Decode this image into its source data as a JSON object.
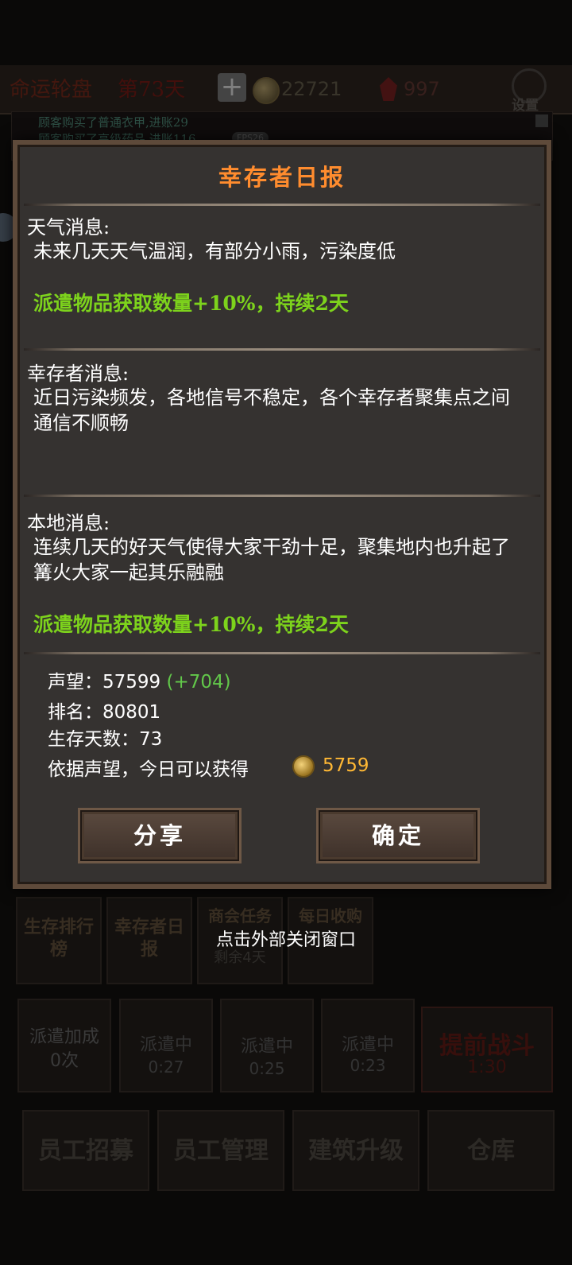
{
  "topbar": {
    "title": "命运轮盘",
    "day": "第73天",
    "coins": "22721",
    "gems": "997",
    "settings_label": "设置"
  },
  "log": {
    "line1": "顾客购买了普通衣甲,进账29",
    "line2": "顾客购买了高级药品,进账116",
    "badge": "FPS26"
  },
  "dialog": {
    "title": "幸存者日报",
    "weather": {
      "heading": "天气消息:",
      "text": "未来几天天气温润，有部分小雨，污染度低",
      "bonus": "派遣物品获取数量+10%，持续2天"
    },
    "survivor": {
      "heading": "幸存者消息:",
      "text": "近日污染频发，各地信号不稳定，各个幸存者聚集点之间通信不顺畅"
    },
    "local": {
      "heading": "本地消息:",
      "text": "连续几天的好天气使得大家干劲十足，聚集地内也升起了篝火大家一起其乐融融",
      "bonus": "派遣物品获取数量+10%，持续2天"
    },
    "stats": {
      "reputation_label": "声望：",
      "reputation_value": "57599",
      "reputation_delta": "(+704)",
      "rank_label": "排名：",
      "rank_value": "80801",
      "days_label": "生存天数：",
      "days_value": "73",
      "reward_label": "依据声望，今日可以获得",
      "reward_value": "5759"
    },
    "share_button": "分享",
    "confirm_button": "确定"
  },
  "hint": "点击外部关闭窗口",
  "menu": {
    "tile1": "生存排行榜",
    "tile2": "幸存者日报",
    "tile3": "商会任务",
    "tile3_sub": "剩余4天",
    "tile4": "每日收购"
  },
  "dispatch": {
    "bonus_label": "派遣加成",
    "bonus_count": "0次",
    "slots": [
      {
        "label": "派遣中",
        "time": "0:27"
      },
      {
        "label": "派遣中",
        "time": "0:25"
      },
      {
        "label": "派遣中",
        "time": "0:23"
      }
    ],
    "battle_label": "提前战斗",
    "battle_time": "1:30"
  },
  "bottom": {
    "recruit": "员工招募",
    "manage": "员工管理",
    "upgrade": "建筑升级",
    "warehouse": "仓库"
  },
  "colors": {
    "accent_orange": "#ff8c2e",
    "bonus_green": "#7dd31c",
    "gold": "#ffb834"
  }
}
